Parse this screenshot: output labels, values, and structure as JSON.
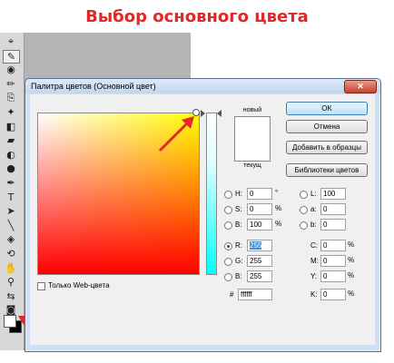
{
  "heading": "Выбор основного цвета",
  "toolbar": {
    "tools": [
      {
        "glyph": "⌖",
        "name": "move-tool-icon"
      },
      {
        "glyph": "✎",
        "name": "eyedropper-tool-icon"
      },
      {
        "glyph": "◉",
        "name": "spot-healing-tool-icon"
      },
      {
        "glyph": "✏",
        "name": "brush-tool-icon"
      },
      {
        "glyph": "⎘",
        "name": "clone-stamp-tool-icon"
      },
      {
        "glyph": "✦",
        "name": "history-brush-tool-icon"
      },
      {
        "glyph": "◧",
        "name": "eraser-tool-icon"
      },
      {
        "glyph": "▰",
        "name": "paint-bucket-tool-icon"
      },
      {
        "glyph": "◐",
        "name": "blur-tool-icon"
      },
      {
        "glyph": "●",
        "name": "dodge-tool-icon"
      },
      {
        "glyph": "✒",
        "name": "pen-tool-icon"
      },
      {
        "glyph": "T",
        "name": "type-tool-icon"
      },
      {
        "glyph": "➤",
        "name": "path-selection-tool-icon"
      },
      {
        "glyph": "╲",
        "name": "line-tool-icon"
      },
      {
        "glyph": "◈",
        "name": "3d-rotate-tool-icon"
      },
      {
        "glyph": "⟲",
        "name": "3d-orbit-tool-icon"
      },
      {
        "glyph": "✋",
        "name": "hand-tool-icon"
      },
      {
        "glyph": "⚲",
        "name": "zoom-tool-icon"
      },
      {
        "glyph": "⇆",
        "name": "swap-colors-icon"
      },
      {
        "glyph": "◙",
        "name": "quick-mask-icon"
      }
    ],
    "foreground_color": "#ffffff",
    "background_color": "#000000"
  },
  "dialog": {
    "title": "Палитра цветов (Основной цвет)",
    "label_new": "новый",
    "label_current": "текущ",
    "buttons": {
      "ok": "OK",
      "cancel": "Отмена",
      "add_swatch": "Добавить в образцы",
      "libraries": "Библиотеки цветов"
    },
    "web_only": "Только Web-цвета",
    "hsb": {
      "h": {
        "label": "H:",
        "value": "0",
        "unit": "°"
      },
      "s": {
        "label": "S:",
        "value": "0",
        "unit": "%"
      },
      "b": {
        "label": "B:",
        "value": "100",
        "unit": "%"
      }
    },
    "rgb": {
      "r": {
        "label": "R:",
        "value": "255"
      },
      "g": {
        "label": "G:",
        "value": "255"
      },
      "b": {
        "label": "B:",
        "value": "255"
      }
    },
    "lab": {
      "l": {
        "label": "L:",
        "value": "100"
      },
      "a": {
        "label": "a:",
        "value": "0"
      },
      "b": {
        "label": "b:",
        "value": "0"
      }
    },
    "cmyk": {
      "c": {
        "label": "C:",
        "value": "0",
        "unit": "%"
      },
      "m": {
        "label": "M:",
        "value": "0",
        "unit": "%"
      },
      "y": {
        "label": "Y:",
        "value": "0",
        "unit": "%"
      },
      "k": {
        "label": "K:",
        "value": "0",
        "unit": "%"
      }
    },
    "hex": {
      "label": "#",
      "value": "ffffff"
    },
    "selected_color": "#ffffff",
    "accent_annotation_color": "#e32626"
  }
}
